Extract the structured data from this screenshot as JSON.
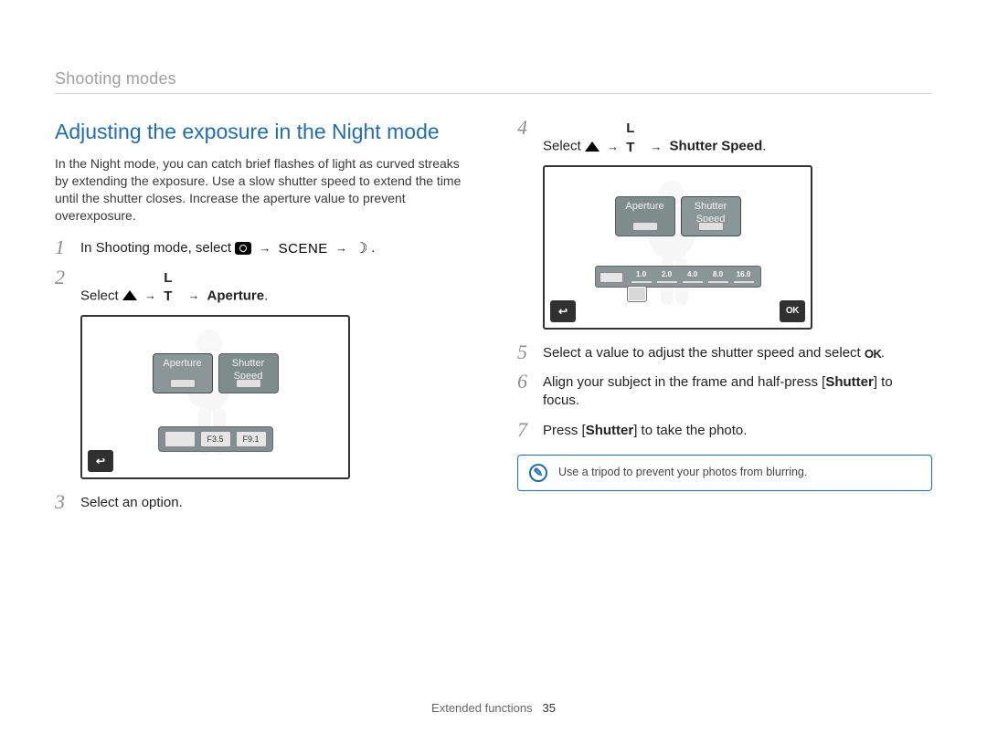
{
  "section_label": "Shooting modes",
  "title": "Adjusting the exposure in the Night mode",
  "intro": "In the Night mode, you can catch brief flashes of light as curved streaks by extending the exposure. Use a slow shutter speed to extend the time until the shutter closes. Increase the aperture value to prevent overexposure.",
  "icons": {
    "scene_text": "SCENE",
    "lt_text": "L T",
    "ok_text": "OK",
    "aperture_f1": "F3.5",
    "aperture_f2": "F9.1"
  },
  "steps": {
    "1": {
      "num": "1",
      "pre": "In Shooting mode, select "
    },
    "2": {
      "num": "2",
      "pre": "Select ",
      "target": "Aperture"
    },
    "3": {
      "num": "3",
      "text": "Select an option."
    },
    "4": {
      "num": "4",
      "pre": "Select ",
      "target": "Shutter Speed"
    },
    "5": {
      "num": "5",
      "pre": "Select a value to adjust the shutter speed and select "
    },
    "6": {
      "num": "6",
      "pre": "Align your subject in the frame and half-press [",
      "btn": "Shutter",
      "post": "] to focus."
    },
    "7": {
      "num": "7",
      "pre": "Press [",
      "btn": "Shutter",
      "post": "] to take the photo."
    }
  },
  "screen1": {
    "tab_aperture": "Aperture",
    "tab_shutter_line1": "Shutter",
    "tab_shutter_line2": "Speed"
  },
  "screen2": {
    "tab_aperture": "Aperture",
    "tab_shutter_line1": "Shutter",
    "tab_shutter_line2": "Speed",
    "ticks": [
      "1.0",
      "2.0",
      "4.0",
      "8.0",
      "16.0"
    ],
    "ok_label": "OK"
  },
  "tip": "Use a tripod to prevent your photos from blurring.",
  "footer_label": "Extended functions",
  "footer_page": "35"
}
